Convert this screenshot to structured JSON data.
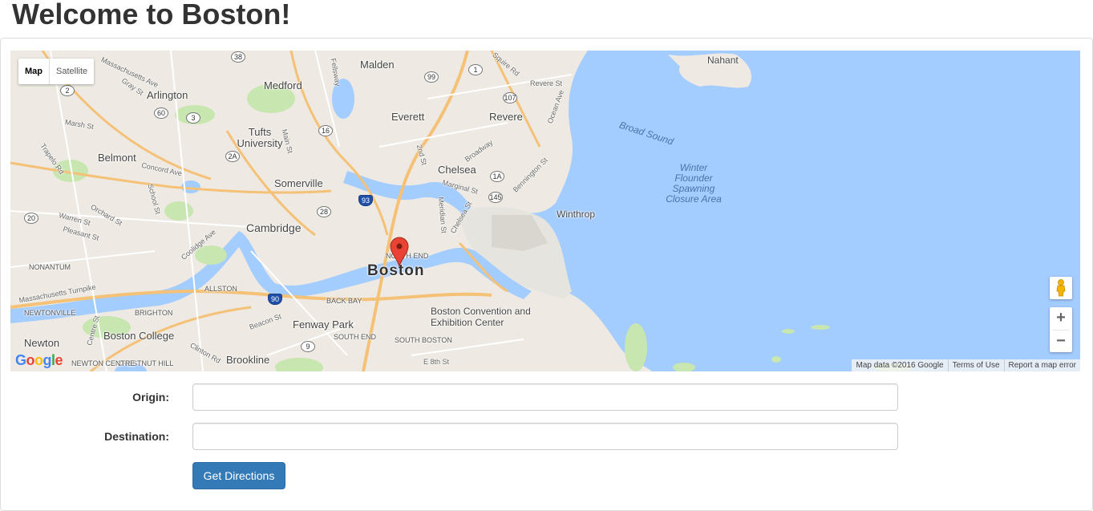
{
  "page": {
    "title": "Welcome to Boston!"
  },
  "map": {
    "type_controls": {
      "map": "Map",
      "satellite": "Satellite"
    },
    "labels": {
      "big_cities": [
        "Boston"
      ],
      "cities": [
        "Malden",
        "Medford",
        "Arlington",
        "Everett",
        "Revere",
        "Nahant",
        "Tufts University",
        "Belmont",
        "Somerville",
        "Chelsea",
        "Cambridge",
        "Winthrop",
        "Fenway Park",
        "Boston Convention and Exhibition Center",
        "Newton",
        "Boston College",
        "Brookline"
      ],
      "neighborhoods": [
        "North End",
        "Nonantum",
        "Allston",
        "Back Bay",
        "Brighton",
        "Newtonville",
        "South End",
        "South Boston",
        "Chestnut Hill",
        "Newton Centre"
      ],
      "water": [
        "Broad Sound",
        "Winter Flounder Spawning Closure Area"
      ],
      "streets": [
        "Massachusetts Ave",
        "Gray St",
        "Marsh St",
        "Trapelo Rd",
        "Concord Ave",
        "School St",
        "Orchard St",
        "Warren St",
        "Pleasant St",
        "Coolidge Ave",
        "Massachusetts Turnpike",
        "Beacon St",
        "Clinton Rd",
        "Fellsway",
        "Main St",
        "Broadway",
        "2nd St",
        "Marginal St",
        "Meridian St",
        "Chelsea St",
        "Bennington St",
        "Ocean Ave",
        "Revere St",
        "Squire Rd",
        "Centre St",
        "E 8th St"
      ],
      "route_shields": [
        "38",
        "99",
        "1",
        "107",
        "2",
        "60",
        "3",
        "16",
        "2A",
        "28",
        "1A",
        "145",
        "20",
        "9",
        "93",
        "90"
      ]
    },
    "attribution": {
      "data": "Map data ©2016 Google",
      "terms": "Terms of Use",
      "report": "Report a map error"
    },
    "logo_text": "Google",
    "colors": {
      "water": "#a3ccff",
      "land": "#eeeae3",
      "park": "#c8e6b0",
      "highway": "#f4c177",
      "marker": "#ea4335"
    }
  },
  "form": {
    "origin_label": "Origin:",
    "origin_value": "",
    "destination_label": "Destination:",
    "destination_value": "",
    "submit_label": "Get Directions"
  }
}
